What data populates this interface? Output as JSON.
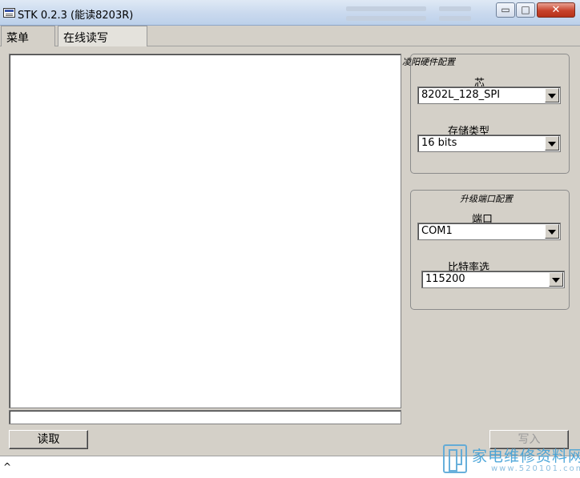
{
  "window": {
    "title": "STK 0.2.3 (能读8203R)",
    "controls": {
      "minimize": "▭",
      "maximize": "□",
      "close": "✕"
    }
  },
  "tabs": [
    {
      "label": "菜单",
      "active": false
    },
    {
      "label": "在线读写",
      "active": true
    }
  ],
  "hardware_config": {
    "group_label": "凌阳硬件配置",
    "chip_label": "芯",
    "chip_value": "8202L_128_SPI",
    "storage_label": "存储类型",
    "storage_value": "16 bits"
  },
  "port_config": {
    "group_label": "升级端口配置",
    "port_label": "端口",
    "port_value": "COM1",
    "baud_label": "比特率选",
    "baud_value": "115200"
  },
  "actions": {
    "read_label": "读取",
    "write_label": "写入",
    "write_enabled": false
  },
  "progress": {
    "percent": 0
  },
  "status": {
    "text": "^"
  },
  "watermark": {
    "text": "家电维修资料网",
    "url": "www.520101.com"
  },
  "colors": {
    "face": "#d4d0c8",
    "title_bar": "#c9d9ee",
    "close_button": "#c7422b",
    "watermark": "#3e9fd6"
  }
}
